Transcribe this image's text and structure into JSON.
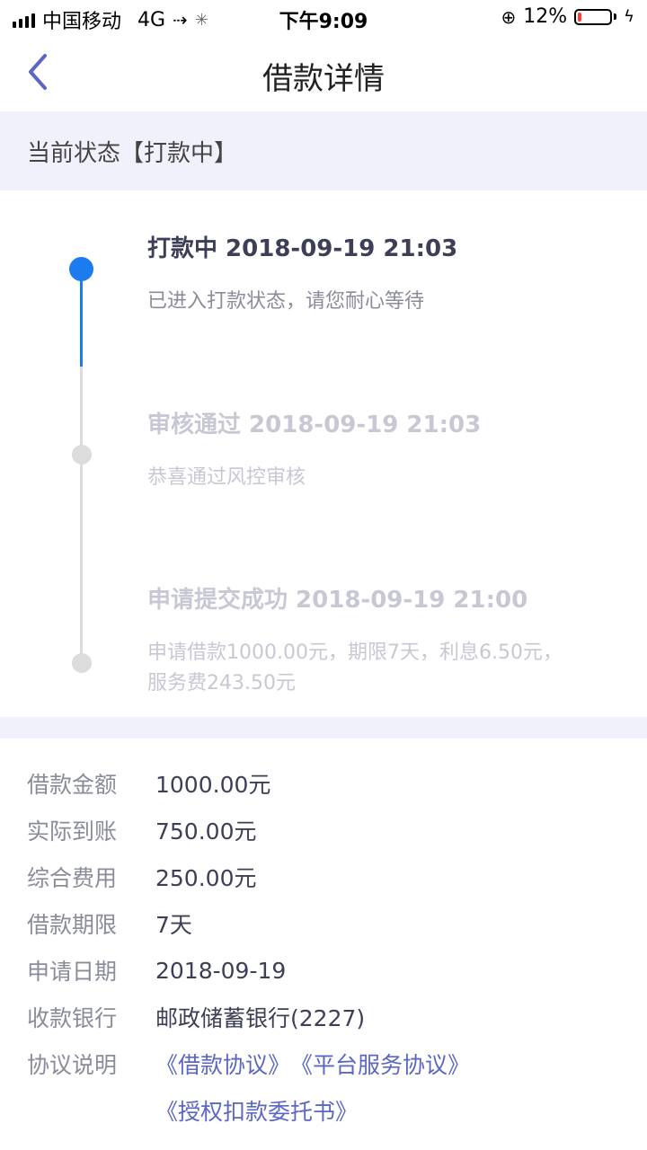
{
  "status_bar": {
    "carrier": "中国移动",
    "network": "4G",
    "time": "下午9:09",
    "battery": "12%",
    "battery_level": 0.12
  },
  "nav": {
    "title": "借款详情"
  },
  "current_state": "当前状态【打款中】",
  "timeline": [
    {
      "title": "打款中 2018-09-19 21:03",
      "desc": "已进入打款状态，请您耐心等待",
      "active": true
    },
    {
      "title": "审核通过 2018-09-19 21:03",
      "desc": "恭喜通过风控审核",
      "active": false
    },
    {
      "title": "申请提交成功 2018-09-19 21:00",
      "desc_line1": "申请借款1000.00元，期限7天，利息6.50元，",
      "desc_line2": "服务费243.50元",
      "active": false
    }
  ],
  "details": [
    {
      "label": "借款金额",
      "value": "1000.00元"
    },
    {
      "label": "实际到账",
      "value": "750.00元"
    },
    {
      "label": "综合费用",
      "value": "250.00元"
    },
    {
      "label": "借款期限",
      "value": "7天"
    },
    {
      "label": "申请日期",
      "value": "2018-09-19"
    },
    {
      "label": "收款银行",
      "value": "邮政储蓄银行(2227)"
    }
  ],
  "agreements": {
    "label": "协议说明",
    "links": [
      "《借款协议》",
      "《平台服务协议》",
      "《授权扣款委托书》"
    ]
  },
  "colors": {
    "accent": "#1b7bef",
    "link": "#5b67c2",
    "section_bg": "#f0f1fa"
  }
}
